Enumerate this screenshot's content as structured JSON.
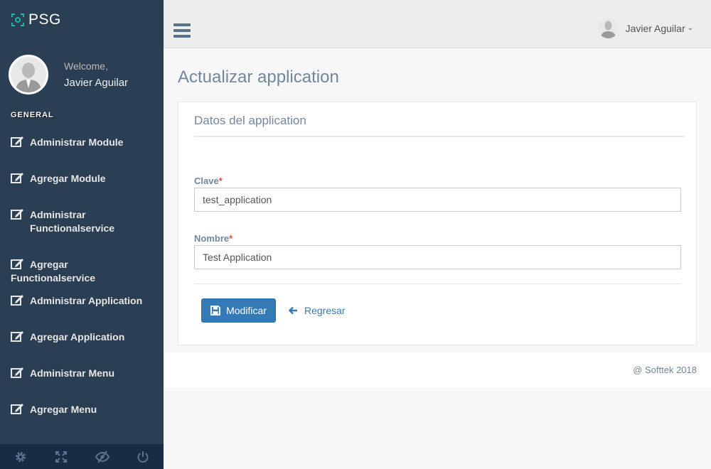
{
  "brand": {
    "name": "PSG"
  },
  "profile": {
    "welcome": "Welcome,",
    "name": "Javier Aguilar"
  },
  "sidebar": {
    "section": "GENERAL",
    "items": [
      {
        "label": "Administrar Module",
        "icon": "edit-icon"
      },
      {
        "label": "Agregar Module",
        "icon": "edit-icon"
      },
      {
        "label": "Administrar Functionalservice",
        "icon": "edit-icon"
      },
      {
        "label": "Agregar Functionalservice",
        "icon": "edit-icon"
      },
      {
        "label": "Administrar Application",
        "icon": "edit-icon"
      },
      {
        "label": "Agregar Application",
        "icon": "edit-icon"
      },
      {
        "label": "Administrar Menu",
        "icon": "edit-icon"
      },
      {
        "label": "Agregar Menu",
        "icon": "edit-icon"
      }
    ],
    "footer_icons": [
      "gear-icon",
      "fullscreen-icon",
      "eye-slash-icon",
      "power-icon"
    ]
  },
  "topnav": {
    "user_name": "Javier Aguilar"
  },
  "page": {
    "title": "Actualizar application"
  },
  "panel": {
    "title": "Datos del application",
    "fields": [
      {
        "label": "Clave",
        "required_mark": "*",
        "value": "test_application"
      },
      {
        "label": "Nombre",
        "required_mark": "*",
        "value": "Test Application"
      }
    ],
    "submit_label": "Modificar",
    "back_label": "Regresar"
  },
  "footer": {
    "text": "@ Softtek 2018"
  },
  "colors": {
    "sidebar": "#2a3f54",
    "primary": "#337ab7",
    "required": "#e74c3c"
  }
}
